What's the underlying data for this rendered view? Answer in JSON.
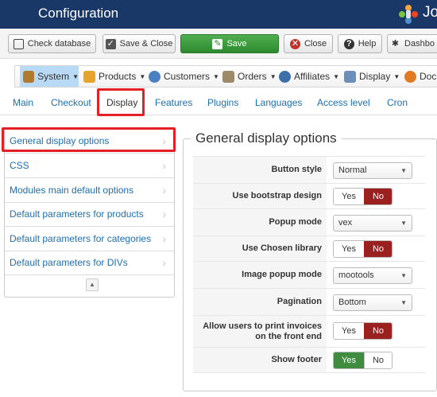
{
  "header": {
    "title": "Configuration",
    "logo_text": "Jo"
  },
  "toolbar": {
    "check_database": "Check database",
    "save_close": "Save & Close",
    "save": "Save",
    "close": "Close",
    "help": "Help",
    "dashboard": "Dashbo"
  },
  "menu": [
    {
      "label": "System",
      "icon": "wrench-icon",
      "active": true
    },
    {
      "label": "Products",
      "icon": "box-icon"
    },
    {
      "label": "Customers",
      "icon": "users-icon"
    },
    {
      "label": "Orders",
      "icon": "orders-icon"
    },
    {
      "label": "Affiliates",
      "icon": "affiliates-icon"
    },
    {
      "label": "Display",
      "icon": "display-icon"
    },
    {
      "label": "Docu",
      "icon": "docs-icon"
    }
  ],
  "tabs": [
    "Main",
    "Checkout",
    "Display",
    "Features",
    "Plugins",
    "Languages",
    "Access level",
    "Cron"
  ],
  "active_tab": "Display",
  "sidebar": {
    "items": [
      "General display options",
      "CSS",
      "Modules main default options",
      "Default parameters for products",
      "Default parameters for categories",
      "Default parameters for DIVs"
    ],
    "active_item": "General display options"
  },
  "section": {
    "title": "General display options",
    "fields": [
      {
        "label": "Button style",
        "type": "select",
        "value": "Normal"
      },
      {
        "label": "Use bootstrap design",
        "type": "toggle",
        "yes": "Yes",
        "no": "No",
        "value": "No"
      },
      {
        "label": "Popup mode",
        "type": "select",
        "value": "vex"
      },
      {
        "label": "Use Chosen library",
        "type": "toggle",
        "yes": "Yes",
        "no": "No",
        "value": "No"
      },
      {
        "label": "Image popup mode",
        "type": "select",
        "value": "mootools"
      },
      {
        "label": "Pagination",
        "type": "select",
        "value": "Bottom"
      },
      {
        "label": "Allow users to print invoices on the front end",
        "type": "toggle",
        "yes": "Yes",
        "no": "No",
        "value": "No"
      },
      {
        "label": "Show footer",
        "type": "toggle",
        "yes": "Yes",
        "no": "No",
        "value": "Yes"
      }
    ]
  },
  "colors": {
    "header_bg": "#1a3867",
    "save_green": "#3f8b3f",
    "no_red": "#9b2020",
    "highlight_red": "#e41f26",
    "link_blue": "#1f6fad"
  }
}
